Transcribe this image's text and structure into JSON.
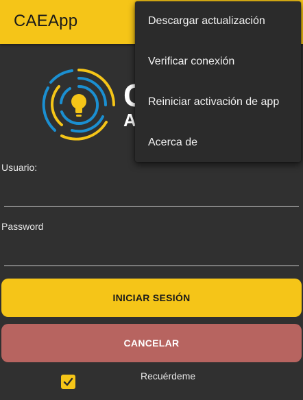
{
  "app": {
    "title": "CAEApp",
    "accent_color": "#f5c518",
    "cancel_color": "#b76460",
    "background_color": "#303030"
  },
  "logo": {
    "text_line1": "C",
    "text_line2": "A"
  },
  "form": {
    "username_label": "Usuario:",
    "username_value": "",
    "password_label": "Password",
    "password_value": "",
    "login_button": "INICIAR SESIÓN",
    "cancel_button": "CANCELAR",
    "remember_label": "Recuérdeme",
    "remember_checked": true
  },
  "overflow_menu": {
    "items": [
      {
        "label": "Descargar actualización"
      },
      {
        "label": "Verificar conexión"
      },
      {
        "label": "Reiniciar activación de app"
      },
      {
        "label": "Acerca de"
      }
    ]
  },
  "icons": {
    "logo": "lightbulb-logo-icon",
    "check": "checkmark-icon"
  }
}
